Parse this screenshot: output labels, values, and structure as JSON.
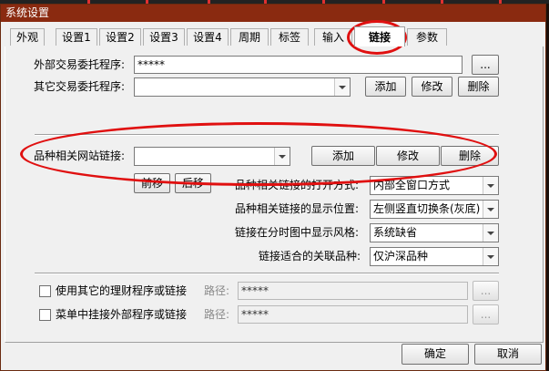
{
  "window": {
    "title": "系统设置"
  },
  "tabs": [
    "外观",
    "设置1",
    "设置2",
    "设置3",
    "设置4",
    "周期",
    "标签",
    "输入",
    "链接",
    "参数"
  ],
  "active_tab": "链接",
  "trade_programs": {
    "external_label": "外部交易委托程序:",
    "external_value": "*****",
    "other_label": "其它交易委托程序:",
    "other_value": "",
    "browse_label": "...",
    "add_label": "添加",
    "modify_label": "修改",
    "delete_label": "删除"
  },
  "site_links": {
    "label": "品种相关网站链接:",
    "value": "",
    "add_label": "添加",
    "modify_label": "修改",
    "delete_label": "删除",
    "move_up_label": "前移",
    "move_down_label": "后移"
  },
  "settings": {
    "open_mode_label": "品种相关链接的打开方式:",
    "open_mode_value": "内部全窗口方式",
    "display_pos_label": "品种相关链接的显示位置:",
    "display_pos_value": "左侧竖直切换条(灰底)",
    "style_label": "链接在分时图中显示风格:",
    "style_value": "系统缺省",
    "assoc_label": "链接适合的关联品种:",
    "assoc_value": "仅沪深品种"
  },
  "finance": {
    "use_other_label": "使用其它的理财程序或链接",
    "path_label": "路径:",
    "path_value": "*****",
    "menu_label": "菜单中挂接外部程序或链接",
    "menu_path_label": "路径:",
    "menu_path_value": "*****",
    "browse_label": "..."
  },
  "footer": {
    "ok_label": "确定",
    "cancel_label": "取消"
  }
}
